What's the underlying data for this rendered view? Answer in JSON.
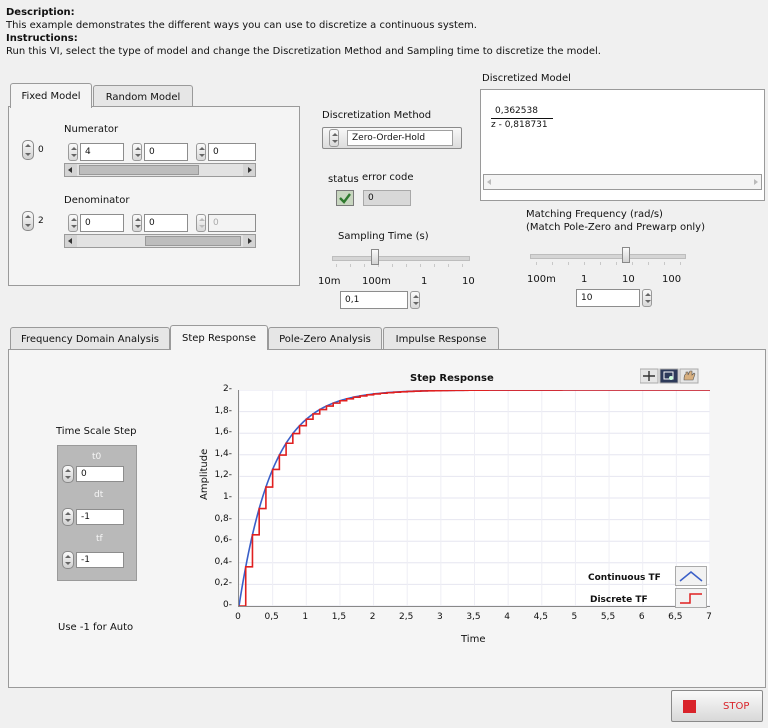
{
  "description": {
    "heading": "Description:",
    "text": "This example demonstrates the different ways you can use to discretize a continuous system.",
    "instr_heading": "Instructions:",
    "instr_text": "Run this VI, select the type of model and change the Discretization Method and Sampling time to discretize the model."
  },
  "model_tabs": [
    "Fixed Model",
    "Random Model"
  ],
  "numerator": {
    "label": "Numerator",
    "index": "0",
    "values": [
      "4",
      "0",
      "0"
    ]
  },
  "denominator": {
    "label": "Denominator",
    "index": "2",
    "values": [
      "0",
      "0",
      "0"
    ]
  },
  "discretization": {
    "label": "Discretization Method",
    "value": "Zero-Order-Hold"
  },
  "status": {
    "status_label": "status",
    "error_label": "error code",
    "error_value": "0"
  },
  "sampling": {
    "label": "Sampling Time (s)",
    "ticks": [
      "10m",
      "100m",
      "1",
      "10"
    ],
    "value": "0,1"
  },
  "discretized_model": {
    "label": "Discretized Model",
    "numerator": "0,362538",
    "denominator": "z - 0,818731"
  },
  "matching": {
    "label1": "Matching Frequency (rad/s)",
    "label2": "(Match Pole-Zero and Prewarp only)",
    "ticks": [
      "100m",
      "1",
      "10",
      "100"
    ],
    "value": "10"
  },
  "analysis_tabs": [
    "Frequency Domain Analysis",
    "Step Response",
    "Pole-Zero Analysis",
    "Impulse Response"
  ],
  "time_scale": {
    "label": "Time Scale Step",
    "t0_label": "t0",
    "t0": "0",
    "dt_label": "dt",
    "dt": "-1",
    "tf_label": "tf",
    "tf": "-1",
    "note": "Use -1 for Auto"
  },
  "chart_data": {
    "type": "line",
    "title": "Step Response",
    "xlabel": "Time",
    "ylabel": "Amplitude",
    "xlim": [
      0,
      7
    ],
    "ylim": [
      0,
      2
    ],
    "x_ticks": [
      "0",
      "0,5",
      "1",
      "1,5",
      "2",
      "2,5",
      "3",
      "3,5",
      "4",
      "4,5",
      "5",
      "5,5",
      "6",
      "6,5",
      "7"
    ],
    "y_ticks": [
      "0",
      "0,2",
      "0,4",
      "0,6",
      "0,8",
      "1",
      "1,2",
      "1,4",
      "1,6",
      "1,8",
      "2"
    ],
    "series": [
      {
        "name": "Continuous TF",
        "color": "#3a5fc8",
        "style": "line",
        "gain": 2,
        "rate": 2
      },
      {
        "name": "Discrete TF",
        "color": "#e02020",
        "style": "step",
        "gain": 2,
        "rate": 2,
        "step": 0.1
      }
    ],
    "legend": "bottom-right"
  },
  "stop": {
    "label": "STOP",
    "color": "#d9232a"
  }
}
